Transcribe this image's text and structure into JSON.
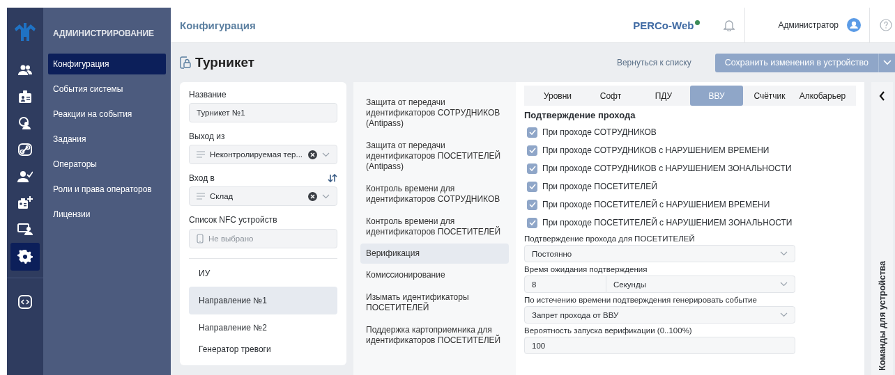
{
  "rail": {
    "items": [
      {
        "kind": "people",
        "selected": false
      },
      {
        "kind": "badge",
        "selected": false
      },
      {
        "kind": "person-target",
        "selected": false
      },
      {
        "kind": "link",
        "selected": false
      },
      {
        "kind": "person-check",
        "selected": false
      },
      {
        "kind": "badge-plus",
        "selected": false
      },
      {
        "kind": "monitor-person",
        "selected": false
      },
      {
        "kind": "gear",
        "selected": true
      }
    ]
  },
  "nav": {
    "title": "АДМИНИСТРИРОВАНИЕ",
    "items": [
      {
        "label": "Конфигурация",
        "selected": true
      },
      {
        "label": "События системы",
        "selected": false
      },
      {
        "label": "Реакции на события",
        "selected": false
      },
      {
        "label": "Задания",
        "selected": false
      },
      {
        "label": "Операторы",
        "selected": false
      },
      {
        "label": "Роли и права операторов",
        "selected": false
      },
      {
        "label": "Лицензии",
        "selected": false
      }
    ]
  },
  "header": {
    "title": "Конфигурация",
    "logo": "PERCo-Web",
    "user": "Администратор"
  },
  "page": {
    "title": "Турникет",
    "back_link": "Вернуться к списку",
    "save_button": "Сохранить изменения в устройство"
  },
  "form": {
    "fields": [
      {
        "kind": "text",
        "label": "Название",
        "value": "Турникет №1"
      },
      {
        "kind": "select",
        "label": "Выход из",
        "value": "Неконтролируемая тер...",
        "swappable": false
      },
      {
        "kind": "select",
        "label": "Вход в",
        "value": "Склад",
        "swappable": true
      },
      {
        "kind": "picker",
        "label": "Список NFC устройств",
        "placeholder": "Не выбрано"
      }
    ],
    "tree": [
      {
        "label": "ИУ",
        "selected": false
      },
      {
        "label": "Направление №1",
        "selected": true
      },
      {
        "label": "Направление №2",
        "selected": false
      },
      {
        "label": "Генератор тревоги",
        "selected": false
      }
    ]
  },
  "sections": [
    {
      "label": "Защита от передачи идентификаторов СОТРУДНИКОВ (Antipass)",
      "selected": false
    },
    {
      "label": "Защита от передачи идентификаторов ПОСЕТИТЕЛЕЙ (Antipass)",
      "selected": false
    },
    {
      "label": "Контроль времени для идентификаторов СОТРУДНИКОВ",
      "selected": false
    },
    {
      "label": "Контроль времени для идентификаторов ПОСЕТИТЕЛЕЙ",
      "selected": false
    },
    {
      "label": "Верификация",
      "selected": true
    },
    {
      "label": "Комиссионирование",
      "selected": false
    },
    {
      "label": "Изымать идентификаторы ПОСЕТИТЕЛЕЙ",
      "selected": false
    },
    {
      "label": "Поддержка картоприемника для идентификаторов ПОСЕТИТЕЛЕЙ",
      "selected": false
    }
  ],
  "tabs": [
    {
      "label": "Уровни",
      "selected": false
    },
    {
      "label": "Софт",
      "selected": false
    },
    {
      "label": "ПДУ",
      "selected": false
    },
    {
      "label": "ВВУ",
      "selected": true
    },
    {
      "label": "Счётчик",
      "selected": false
    },
    {
      "label": "Алкобарьер",
      "selected": false
    }
  ],
  "verification": {
    "heading": "Подтверждение прохода",
    "checkboxes": [
      {
        "label": "При проходе СОТРУДНИКОВ",
        "checked": true
      },
      {
        "label": "При проходе СОТРУДНИКОВ с НАРУШЕНИЕМ ВРЕМЕНИ",
        "checked": true
      },
      {
        "label": "При проходе СОТРУДНИКОВ с НАРУШЕНИЕМ ЗОНАЛЬНОСТИ",
        "checked": true
      },
      {
        "label": "При проходе ПОСЕТИТЕЛЕЙ",
        "checked": true
      },
      {
        "label": "При проходе ПОСЕТИТЕЛЕЙ с НАРУШЕНИЕМ ВРЕМЕНИ",
        "checked": true
      },
      {
        "label": "При проходе ПОСЕТИТЕЛЕЙ с НАРУШЕНИЕМ ЗОНАЛЬНОСТИ",
        "checked": true
      }
    ],
    "fields": [
      {
        "kind": "select",
        "label": "Подтверждение прохода для ПОСЕТИТЕЛЕЙ",
        "value": "Постоянно"
      },
      {
        "kind": "number-unit",
        "label": "Время ожидания подтверждения",
        "value": "8",
        "unit": "Секунды"
      },
      {
        "kind": "select",
        "label": "По истечению времени подтверждения генерировать событие",
        "value": "Запрет прохода от ВВУ"
      },
      {
        "kind": "text",
        "label": "Вероятность запуска верификации (0..100%)",
        "value": "100"
      }
    ]
  },
  "side_panel": {
    "title": "Команды для устройства"
  }
}
